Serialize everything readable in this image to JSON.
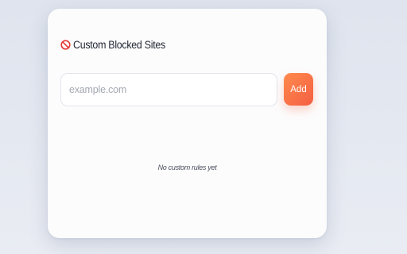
{
  "panel": {
    "icon": "prohibited-icon",
    "title": "Custom Blocked Sites",
    "input": {
      "placeholder": "example.com",
      "value": ""
    },
    "add_label": "Add",
    "empty_message": "No custom rules yet",
    "colors": {
      "accent_start": "#ff8a4c",
      "accent_end": "#f45f43",
      "icon": "#e53935"
    }
  }
}
